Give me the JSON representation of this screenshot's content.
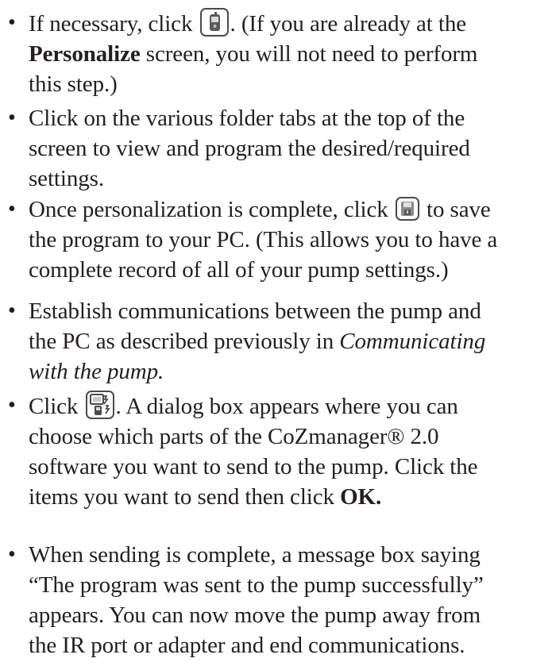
{
  "steps": [
    {
      "before_icon": "If necessary, click",
      "icon": "pump-device-icon",
      "after_icon": ". (If you are already at the",
      "bold": "Personalize",
      "line2_rest": "screen, you will not need to perform",
      "line3": "this step.)"
    },
    {
      "line1": "Click on the various folder tabs at the top of the",
      "line2": "screen to view and program the desired/required",
      "line3": "settings."
    },
    {
      "before_icon": "Once personalization is complete, click",
      "icon": "save-disk-icon",
      "after_icon": "to save",
      "line2": "the program to your PC. (This allows you to have a",
      "line3": "complete record of all of your pump settings.)"
    },
    {
      "line1": "Establish communications between the pump and",
      "line2_plain": "the PC as described previously in",
      "line2_italic": "Communicating",
      "line3_italic": "with the pump."
    },
    {
      "before_icon": "Click",
      "icon": "send-to-pump-icon",
      "after_icon": ". A dialog box appears where you can",
      "line2": "choose which parts of the CoZmanager® 2.0",
      "line3": "software you want to send to the pump. Click the",
      "line4_plain": "items you want to send then click",
      "line4_bold": "OK."
    },
    {
      "line1": "When sending is complete, a message box saying",
      "line2": "“The program was sent to the pump successfully”",
      "line3": "appears. You can now move the pump away from",
      "line4": "the IR port or adapter and end communications."
    }
  ],
  "bullet_char": "•"
}
